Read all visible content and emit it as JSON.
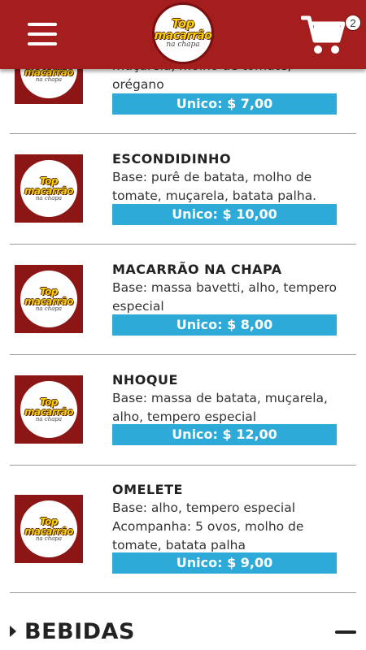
{
  "header": {
    "logo_line1": "Top",
    "logo_line2": "macarrão",
    "logo_line3": "na chapa",
    "cart_count": "2"
  },
  "items": [
    {
      "title": "",
      "desc": "muçarela, molho de tomate, orégano",
      "price": "Unico: $ 7,00"
    },
    {
      "title": "ESCONDIDINHO",
      "desc": "Base: purê de batata, molho de tomate, muçarela, batata palha.",
      "price": "Unico: $ 10,00"
    },
    {
      "title": "MACARRÃO NA CHAPA",
      "desc": "Base: massa bavetti, alho, tempero especial",
      "price": "Unico: $ 8,00"
    },
    {
      "title": "NHOQUE",
      "desc": "Base: massa de batata, muçarela, alho, tempero especial",
      "price": "Unico: $ 12,00"
    },
    {
      "title": "OMELETE",
      "desc": "Base: alho, tempero especial",
      "desc2": "Acompanha: 5 ovos, molho de tomate, batata palha",
      "price": "Unico: $ 9,00"
    }
  ],
  "section": {
    "title": "BEBIDAS"
  },
  "colors": {
    "header": "#a41e1e",
    "price_button": "#2eaad9",
    "logo_yellow": "#f2d40c"
  }
}
